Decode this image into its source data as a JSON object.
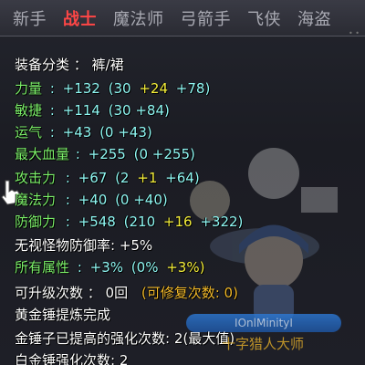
{
  "tabs": [
    {
      "label": "新手",
      "active": false
    },
    {
      "label": "战士",
      "active": true
    },
    {
      "label": "魔法师",
      "active": false
    },
    {
      "label": "弓箭手",
      "active": false
    },
    {
      "label": "飞侠",
      "active": false
    },
    {
      "label": "海盗",
      "active": false
    }
  ],
  "equip": {
    "category_label": "装备分类 ： 裤/裙",
    "str": {
      "label": "力量",
      "colon": ":",
      "total": "+132",
      "base": "(30",
      "bonus1": "+24",
      "bonus2": "+78)"
    },
    "dex": {
      "label": "敏捷",
      "colon": ":",
      "total": "+114",
      "detail": "(30 +84)"
    },
    "luk": {
      "label": "运气",
      "colon": ":",
      "total": "+43",
      "detail": "(0 +43)"
    },
    "hp": {
      "label": "最大血量",
      "colon": ":",
      "total": "+255",
      "detail": "(0 +255)"
    },
    "atk": {
      "label": "攻击力",
      "colon": ":",
      "total": "+67",
      "base": "(2",
      "bonus1": "+1",
      "bonus2": "+64)"
    },
    "matk": {
      "label": "魔法力",
      "colon": ":",
      "total": "+40",
      "detail": "(0 +40)"
    },
    "def": {
      "label": "防御力",
      "colon": ":",
      "total": "+548",
      "base": "(210",
      "bonus1": "+16",
      "bonus2": "+322)"
    },
    "ignore_def": "无视怪物防御率: +5%",
    "all_stats": {
      "label": "所有属性",
      "colon": ":",
      "total": "+3%",
      "detail": "(0%",
      "bonus": "+3%)"
    },
    "upgrades": {
      "label": "可升级次数 ： 0回",
      "repair": "(可修复次数: 0)"
    },
    "golden_hammer": "黄金锤提炼完成",
    "hammer_count": "金锤子已提高的强化次数: 2(最大值)",
    "white_hammer": "白金锤强化次数: 2"
  },
  "background": {
    "nameplate": "ⅠOnlMinityⅠ",
    "npc_title": "十字猎人大师"
  }
}
